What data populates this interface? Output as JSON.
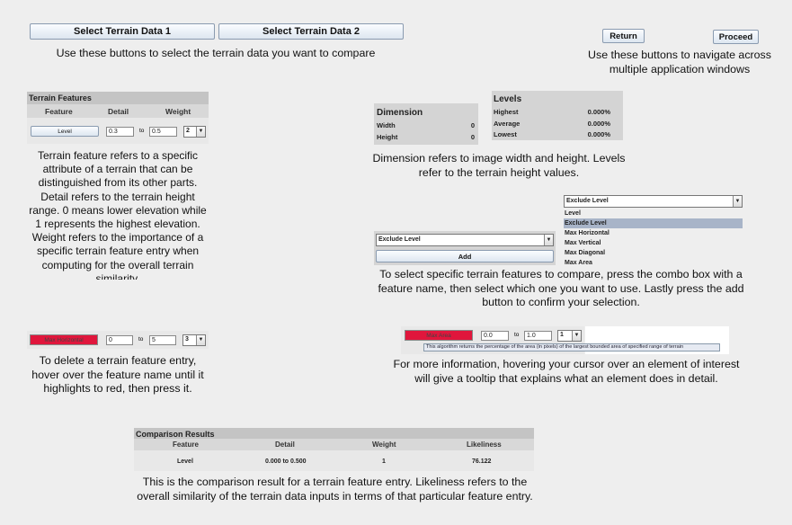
{
  "top_buttons": {
    "select_terrain_1": "Select Terrain Data 1",
    "select_terrain_2": "Select Terrain Data 2",
    "return": "Return",
    "proceed": "Proceed"
  },
  "descriptions": {
    "select_terrain": "Use these buttons to select the terrain data you want to compare",
    "navigate": "Use these buttons to navigate across multiple application windows",
    "terrain_feature": "Terrain feature refers to a specific attribute of a terrain that can be distinguished from its other parts. Detail refers to the terrain height range. 0 means lower elevation while 1 represents the highest elevation. Weight refers to the importance of a specific terrain feature entry when computing for the overall terrain similarity.",
    "dimension_levels": "Dimension refers to image width and height. Levels refer to the terrain height values.",
    "combo_box": "To select specific terrain features to compare, press the combo box with a feature name, then select which one you want to use. Lastly press the add button to confirm your selection.",
    "delete_entry": "To delete a terrain feature entry, hover over the feature name until it highlights to red, then press it.",
    "tooltip_info": "For more information, hovering your cursor over an element of interest will give a tooltip that explains what an element does in detail.",
    "comparison": "This is the comparison result for a terrain feature entry. Likeliness refers to the overall similarity of the terrain data inputs in terms of that particular feature entry."
  },
  "terrain_features": {
    "title": "Terrain Features",
    "headers": [
      "Feature",
      "Detail",
      "Weight"
    ],
    "row": {
      "feature": "Level",
      "from": "0.3",
      "to_label": "to",
      "to": "0.5",
      "weight": "2"
    }
  },
  "dimension": {
    "title": "Dimension",
    "rows": [
      {
        "label": "Width",
        "value": "0"
      },
      {
        "label": "Height",
        "value": "0"
      }
    ]
  },
  "levels": {
    "title": "Levels",
    "rows": [
      {
        "label": "Highest",
        "value": "0.000%"
      },
      {
        "label": "Average",
        "value": "0.000%"
      },
      {
        "label": "Lowest",
        "value": "0.000%"
      }
    ]
  },
  "feature_dropdown": {
    "selected": "Exclude Level",
    "options": [
      "Level",
      "Exclude Level",
      "Max Horizontal",
      "Max Vertical",
      "Max Diagonal",
      "Max Area"
    ]
  },
  "add_panel": {
    "combo_value": "Exclude Level",
    "add_label": "Add"
  },
  "delete_example": {
    "feature": "Max Horizontal",
    "from": "0",
    "to_label": "to",
    "to": "5",
    "weight": "3"
  },
  "tooltip_example": {
    "feature": "Max Area",
    "from": "0.0",
    "to_label": "to",
    "to": "1.0",
    "weight": "1",
    "tooltip": "This algorithm returns the percentage of the area (in pixels) of the largest bounded area of specified range of terrain"
  },
  "comparison_results": {
    "title": "Comparison Results",
    "headers": [
      "Feature",
      "Detail",
      "Weight",
      "Likeliness"
    ],
    "row": {
      "feature": "Level",
      "detail": "0.000 to 0.500",
      "weight": "1",
      "likeliness": "76.122"
    }
  },
  "colors": {
    "background": "#eeeeee",
    "panel": "#d4d4d4",
    "highlight_red": "#e0163c",
    "selected_option": "#a8b4c8",
    "tooltip_bg": "#e6eaf2"
  }
}
